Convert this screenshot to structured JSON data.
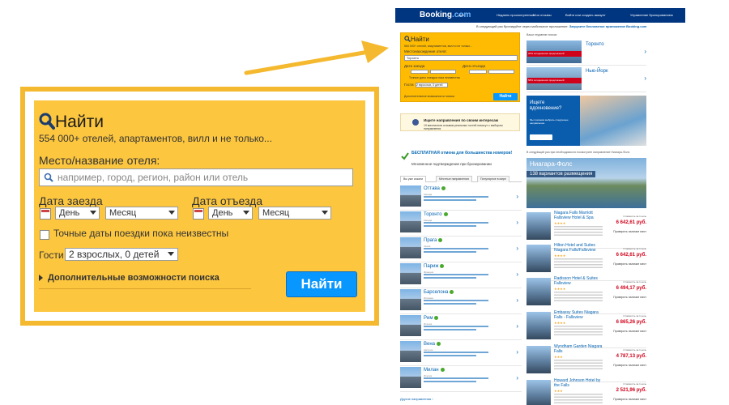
{
  "zoom": {
    "title": "Найти",
    "subtitle": "554 000+ отелей, апартаментов, вилл и не только...",
    "destination_label": "Место/название отеля:",
    "destination_placeholder": "например, город, регион, район или отель",
    "checkin_label": "Дата заезда",
    "checkout_label": "Дата отъезда",
    "day_option": "День",
    "month_option": "Месяц",
    "flexible_label": "Точные даты поездки пока неизвестны",
    "guests_label": "Гости",
    "guests_value": "2 взрослых, 0 детей",
    "more_options": "Дополнительные возможности поиска",
    "search_button": "Найти"
  },
  "page": {
    "logo_main": "Booking",
    "logo_suffix": ".com",
    "topbar": [
      "руб.",
      "Недавно просмотренные",
      "Мои отзывы",
      "Войти или создать аккаунт",
      "Управление бронированием"
    ],
    "promo_text": "В следующий раз бронируйте через мобильное приложение.",
    "promo_link": "Загрузите бесплатное приложение Booking.com",
    "search": {
      "title": "Найти",
      "subtitle": "554 000+ отелей, апартаментов, вилл и не только...",
      "dest_label": "Местонахождение отеля:",
      "dest_value": "Торонто",
      "checkin": "Дата заезда",
      "checkout": "Дата отъезда",
      "flexible": "Точные даты поездки пока неизвестны",
      "guests": "Гости",
      "guests_value": "2 взрослых, 0 детей",
      "more": "Дополнительные возможности поиска",
      "button": "Найти"
    },
    "interest": {
      "title": "Ищите направления по своим интересам",
      "text": "19 миллионов отзывов реальных гостей помогут с выбором направления"
    },
    "free_cancel": "БЕСПЛАТНАЯ отмена для большинства номеров!",
    "instant": "Мгновенное подтверждение при бронировании",
    "tabs": [
      "Вы уже искали",
      "Местные направления",
      "Популярное в мире"
    ],
    "cities": [
      {
        "name": "Оттава",
        "country": "Канада"
      },
      {
        "name": "Торонто",
        "country": "Канада"
      },
      {
        "name": "Прага",
        "country": "Чехия"
      },
      {
        "name": "Париж",
        "country": "Франция"
      },
      {
        "name": "Барселона",
        "country": "Испания"
      },
      {
        "name": "Рим",
        "country": "Италия"
      },
      {
        "name": "Вена",
        "country": "Австрия"
      },
      {
        "name": "Милан",
        "country": "Италия"
      }
    ],
    "more_destinations": "Другие направления ›",
    "right_header": "Ваши недавние поиски",
    "deals": [
      {
        "name": "Торонто",
        "tag": "20% сегодняшних предложений"
      },
      {
        "name": "Нью-Йорк",
        "tag": "58% сегодняшних предложений"
      }
    ],
    "inspo": {
      "title": "Ищете вдохновение?",
      "text": "Мы поможем выбрать следующее направление"
    },
    "niagara_header": "В следующий раз при необходимости посмотрите направление Ниагара-Фолс",
    "niagara_title": "Ниагара-Фолс",
    "niagara_sub": "138 вариантов размещения",
    "hotels": [
      {
        "name": "Niagara Falls Marriott Fallsview Hotel & Spa",
        "stars": "★★★★",
        "price": "6 642,61 руб."
      },
      {
        "name": "Hilton Hotel and Suites Niagara Falls/Fallsview",
        "stars": "★★★★",
        "price": "6 642,61 руб."
      },
      {
        "name": "Radisson Hotel & Suites Fallsview",
        "stars": "★★★★",
        "price": "6 494,17 руб."
      },
      {
        "name": "Embassy Suites Niagara Falls - Fallsview",
        "stars": "★★★★",
        "price": "6 865,26 руб."
      },
      {
        "name": "Wyndham Garden Niagara Falls",
        "stars": "★★★",
        "price": "4 787,13 руб."
      },
      {
        "name": "Howard Johnson Hotel by the Falls",
        "stars": "★★★",
        "price": "2 521,96 руб."
      }
    ],
    "price_label": "Стоимость за 1 ночь",
    "check_btn": "Проверить наличие мест"
  },
  "colors": {
    "brand_blue": "#003580",
    "search_yellow": "#fcc63f",
    "button_blue": "#0896ff",
    "border_orange": "#f5b92f"
  }
}
